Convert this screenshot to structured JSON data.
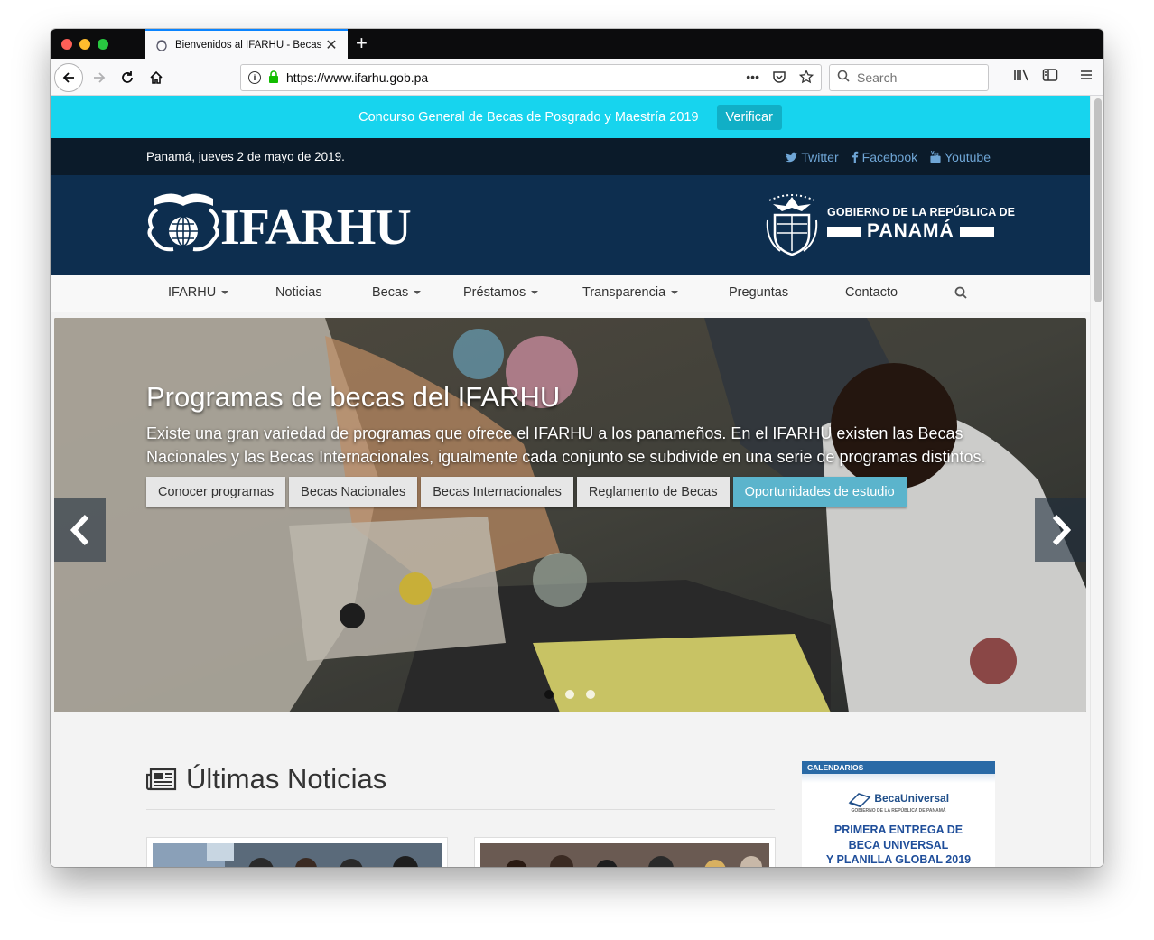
{
  "browser": {
    "tab_title": "Bienvenidos al IFARHU - Becas",
    "url": "https://www.ifarhu.gob.pa",
    "search_placeholder": "Search"
  },
  "announcement": {
    "text": "Concurso General de Becas de Posgrado y Maestría 2019",
    "button": "Verificar"
  },
  "topbar": {
    "date": "Panamá, jueves 2 de mayo de 2019.",
    "social": [
      "Twitter",
      "Facebook",
      "Youtube"
    ]
  },
  "header": {
    "logo_text": "IFARHU",
    "gov_line1": "GOBIERNO DE LA REPÚBLICA DE",
    "gov_line2": "PANAMÁ"
  },
  "nav": {
    "items": [
      {
        "label": "IFARHU",
        "dropdown": true
      },
      {
        "label": "Noticias",
        "dropdown": false
      },
      {
        "label": "Becas",
        "dropdown": true
      },
      {
        "label": "Préstamos",
        "dropdown": true
      },
      {
        "label": "Transparencia",
        "dropdown": true
      },
      {
        "label": "Preguntas",
        "dropdown": false
      },
      {
        "label": "Contacto",
        "dropdown": false
      }
    ]
  },
  "hero": {
    "title": "Programas de becas del IFARHU",
    "description": "Existe una gran variedad de programas que ofrece el IFARHU a los panameños. En el IFARHU existen las Becas Nacionales y las Becas Internacionales, igualmente cada conjunto se subdivide en una serie de programas distintos.",
    "buttons": [
      "Conocer programas",
      "Becas Nacionales",
      "Becas Internacionales",
      "Reglamento de Becas",
      "Oportunidades de estudio"
    ],
    "active_slide": 1,
    "slide_count": 3
  },
  "news": {
    "heading": "Últimas Noticias"
  },
  "promo": {
    "header": "CALENDARIOS",
    "logo": "BecaUniversal",
    "logo_sub": "GOBIERNO DE LA REPÚBLICA DE PANAMÁ",
    "lines": [
      "PRIMERA ENTREGA DE",
      "BECA UNIVERSAL",
      "Y PLANILLA GLOBAL 2019"
    ]
  },
  "colors": {
    "announce_bg": "#17d4ee",
    "topbar_bg": "#0b1b2a",
    "header_bg": "#0d2e4f",
    "accent": "#5bb4cc"
  }
}
